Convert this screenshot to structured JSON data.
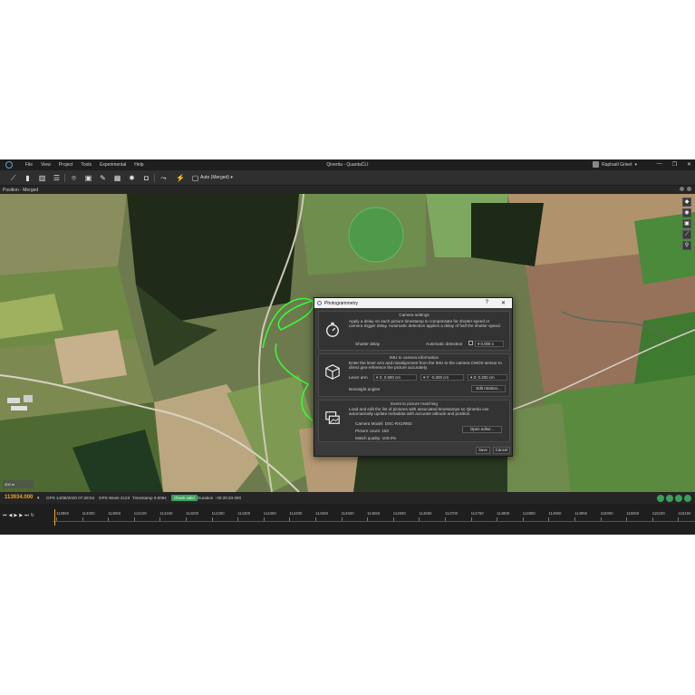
{
  "window": {
    "title": "Qinertia - QuantaCLI",
    "menu": [
      "File",
      "View",
      "Project",
      "Tools",
      "Experimental",
      "Help"
    ],
    "user": "Raphaël Grivet",
    "controls": [
      "—",
      "❐",
      "✕"
    ]
  },
  "toolbar": {
    "mode_label": "Auto (Merged)"
  },
  "panel": {
    "title": "Position - Merged"
  },
  "map": {
    "scale_label": "200 m"
  },
  "dialog": {
    "title": "Photogrammetry",
    "help": "?",
    "close": "✕",
    "camera": {
      "title": "Camera settings",
      "desc": "Apply a delay on each picture timestamp to compensate for shutter speed or camera trigger delay. Automatic detection applies a delay of half the shutter speed.",
      "shutter_label": "Shutter delay",
      "auto_label": "Automatic detection",
      "shutter_value": "0.000 s"
    },
    "imu": {
      "title": "IMU to camera information",
      "desc": "Enter the lever arm and misalignment from the IMU to the camera CMOS sensor to direct geo-reference the picture accurately.",
      "lever_label": "Lever arm",
      "x": "X: 0.500 cm",
      "y": "Y: -0.200 cm",
      "z": "Z: 0.200 cm",
      "boresight_label": "Boresight angles",
      "edit_rotation": "Edit rotation..."
    },
    "event": {
      "title": "Event to picture matching",
      "desc": "Load and edit the list of pictures with associated timestamps so Qinertia can automatically update metadata with accurate attitude and position.",
      "camera_model": "Camera Model:  DSC-RX1RM2",
      "picture_count": "Picture count:  150",
      "match_quality": "Match quality:  100.0%",
      "open_editor": "Open editor..."
    },
    "save": "Save",
    "cancel": "Cancel"
  },
  "status": {
    "timestamp": "113934.000",
    "gps_date": "GPS 14/08/2020 07:28:54",
    "gps_week": "GPS Week 2123",
    "timestep": "Timestamp 0.006s",
    "badge": "Check valid",
    "duration": "Duration : 00:20:33.000"
  },
  "timeline": {
    "ticks": [
      "113950",
      "114000",
      "114050",
      "114100",
      "114150",
      "114200",
      "114250",
      "114300",
      "114350",
      "114400",
      "114450",
      "114500",
      "114550",
      "114600",
      "114650",
      "114700",
      "114750",
      "114800",
      "114850",
      "114900",
      "114950",
      "115000",
      "115050",
      "115100",
      "115150"
    ]
  },
  "colors": {
    "trajectory": "#37ff3a",
    "accent_orange": "#f5a623",
    "status_green": "#3aa05a"
  }
}
